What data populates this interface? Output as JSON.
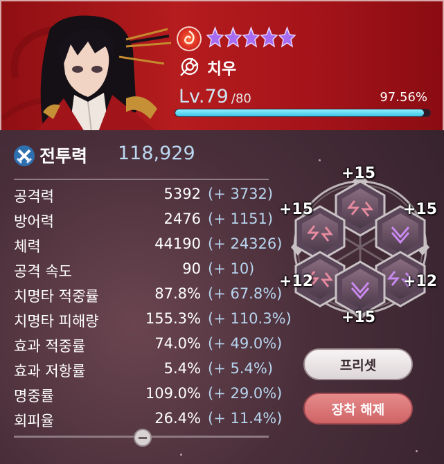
{
  "header": {
    "character_name": "치우",
    "star_count": 5,
    "element_icon": "fire-element-icon",
    "class_icon": "target-class-icon",
    "level_label": "Lv.79",
    "level_max": "/80",
    "exp_percent_text": "97.56%",
    "exp_fraction": 0.9756
  },
  "combat_power": {
    "label": "전투력",
    "value": "118,929"
  },
  "stats": [
    {
      "name": "공격력",
      "value": "5392",
      "bonus": "(+ 3732)"
    },
    {
      "name": "방어력",
      "value": "2476",
      "bonus": "(+ 1151)"
    },
    {
      "name": "체력",
      "value": "44190",
      "bonus": "(+ 24326)"
    },
    {
      "name": "공격 속도",
      "value": "90",
      "bonus": "(+ 10)"
    },
    {
      "name": "치명타 적중률",
      "value": "87.8%",
      "bonus": "(+ 67.8%)"
    },
    {
      "name": "치명타 피해량",
      "value": "155.3%",
      "bonus": "(+ 110.3%)"
    },
    {
      "name": "효과 적중률",
      "value": "74.0%",
      "bonus": "(+ 49.0%)"
    },
    {
      "name": "효과 저항률",
      "value": "5.4%",
      "bonus": "(+ 5.4%)"
    },
    {
      "name": "명중률",
      "value": "109.0%",
      "bonus": "(+ 29.0%)"
    },
    {
      "name": "회피율",
      "value": "26.4%",
      "bonus": "(+ 11.4%)"
    }
  ],
  "runes": {
    "top": "+15",
    "upper_left": "+15",
    "upper_right": "+15",
    "lower_left": "+12",
    "lower_right": "+12",
    "bottom": "+15"
  },
  "buttons": {
    "preset": "프리셋",
    "unequip": "장착 해제"
  },
  "colors": {
    "header_red": "#b51c1e",
    "exp_bar": "#3fc3e6",
    "bonus_text": "#b8d5f0",
    "unequip_button": "#cf6466"
  }
}
